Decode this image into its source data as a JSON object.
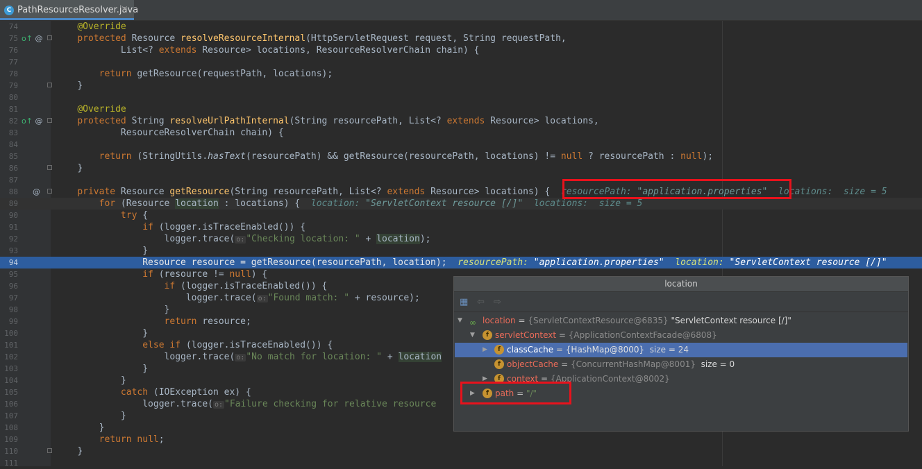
{
  "tab": {
    "filename": "PathResourceResolver.java",
    "close": "×",
    "icon_letter": "C"
  },
  "gutter_icons": {
    "override": "o↑",
    "at": "@"
  },
  "lines": {
    "74": "74",
    "75": "75",
    "76": "76",
    "77": "77",
    "78": "78",
    "79": "79",
    "80": "80",
    "81": "81",
    "82": "82",
    "83": "83",
    "84": "84",
    "85": "85",
    "86": "86",
    "87": "87",
    "88": "88",
    "89": "89",
    "90": "90",
    "91": "91",
    "92": "92",
    "93": "93",
    "94": "94",
    "95": "95",
    "96": "96",
    "97": "97",
    "98": "98",
    "99": "99",
    "100": "100",
    "101": "101",
    "102": "102",
    "103": "103",
    "104": "104",
    "105": "105",
    "106": "106",
    "107": "107",
    "108": "108",
    "109": "109",
    "110": "110",
    "111": "111"
  },
  "code": {
    "l74_ann": "@Override",
    "l75_a": "protected",
    "l75_b": " Resource ",
    "l75_fn": "resolveResourceInternal",
    "l75_c": "(HttpServletRequest request, String requestPath,",
    "l76_a": "        List<? ",
    "l76_kw": "extends",
    "l76_b": " Resource> locations, ResourceResolverChain chain) {",
    "l78_kw": "return",
    "l78_a": " getResource(requestPath, locations);",
    "l79": "}",
    "l81_ann": "@Override",
    "l82_a": "protected",
    "l82_b": " String ",
    "l82_fn": "resolveUrlPathInternal",
    "l82_c": "(String resourcePath, List<? ",
    "l82_kw": "extends",
    "l82_d": " Resource> locations,",
    "l83": "        ResourceResolverChain chain) {",
    "l85_kw": "return",
    "l85_a": " (StringUtils.",
    "l85_st": "hasText",
    "l85_b": "(resourcePath) && getResource(resourcePath, locations) != ",
    "l85_kw2": "null",
    "l85_c": " ? resourcePath : ",
    "l85_kw3": "null",
    "l85_d": ");",
    "l86": "}",
    "l88_kw": "private",
    "l88_a": " Resource ",
    "l88_fn": "getResource",
    "l88_b": "(String resourcePath, List<? ",
    "l88_kw2": "extends",
    "l88_c": " Resource> locations) {",
    "l88_i1": "resourcePath: ",
    "l88_i1v": "\"application.properties\"",
    "l88_i2": "locations:  size = 5",
    "l89_kw": "for",
    "l89_a": " (Resource ",
    "l89_var": "location",
    "l89_b": " : locations) {",
    "l89_i1": "location: ",
    "l89_i1v": "\"ServletContext resource [/]\"",
    "l89_i2": "locations:  size = 5",
    "l90_kw": "try",
    "l90_a": " {",
    "l91_kw": "if",
    "l91_a": " (logger.isTraceEnabled()) {",
    "l92_a": "logger.trace(",
    "l92_hint": "o:",
    "l92_str": "\"Checking location: \"",
    "l92_b": " + ",
    "l92_var": "location",
    "l92_c": ");",
    "l93": "}",
    "l94_a": "Resource resource = getResource(resourcePath, location);",
    "l94_i1": "resourcePath: ",
    "l94_i1v": "\"application.properties\"",
    "l94_i2": "location: ",
    "l94_i2v": "\"ServletContext resource [/]\"",
    "l95_kw": "if",
    "l95_a": " (resource != ",
    "l95_kw2": "null",
    "l95_b": ") {",
    "l96_kw": "if",
    "l96_a": " (logger.isTraceEnabled()) {",
    "l97_a": "logger.trace(",
    "l97_hint": "o:",
    "l97_str": "\"Found match: \"",
    "l97_b": " + resource);",
    "l98": "}",
    "l99_kw": "return",
    "l99_a": " resource;",
    "l100": "}",
    "l101_kw": "else if",
    "l101_a": " (logger.isTraceEnabled()) {",
    "l102_a": "logger.trace(",
    "l102_hint": "o:",
    "l102_str": "\"No match for location: \"",
    "l102_b": " + ",
    "l102_var": "location",
    "l103": "}",
    "l104": "}",
    "l105_kw": "catch",
    "l105_a": " (IOException ex) {",
    "l106_a": "logger.trace(",
    "l106_hint": "o:",
    "l106_str": "\"Failure checking for relative resource",
    "l107": "}",
    "l108": "}",
    "l109_kw": "return null",
    "l109_a": ";",
    "l110": "}"
  },
  "popup": {
    "title": "location",
    "rows": [
      {
        "name": "location",
        "eq": " = ",
        "type": "{ServletContextResource@6835}",
        "val": " \"ServletContext resource [/]\""
      },
      {
        "name": "servletContext",
        "eq": " = ",
        "type": "{ApplicationContextFacade@6808}",
        "val": ""
      },
      {
        "name": "classCache",
        "eq": " = ",
        "type": "{HashMap@8000}",
        "val": "  size = 24"
      },
      {
        "name": "objectCache",
        "eq": " = ",
        "type": "{ConcurrentHashMap@8001}",
        "val": "  size = 0"
      },
      {
        "name": "context",
        "eq": " = ",
        "type": "{ApplicationContext@8002}",
        "val": ""
      },
      {
        "name": "path",
        "eq": " = ",
        "type": "",
        "val": "\"/\""
      }
    ]
  },
  "colors": {
    "highlight_box": "#e8121c",
    "execution_line": "#2d5d9f",
    "selected_row": "#4b6eaf"
  }
}
